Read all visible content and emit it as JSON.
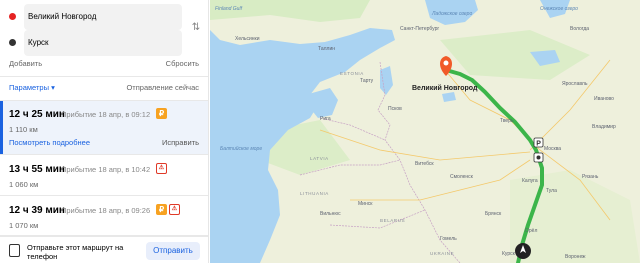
{
  "route_points": {
    "from": "Великий Новгород",
    "to": "Курск",
    "add_label": "Добавить",
    "reset_label": "Сбросить"
  },
  "options": {
    "params_label": "Параметры",
    "departure_label": "Отправление сейчас"
  },
  "routes": [
    {
      "duration": "12 ч 25 мин",
      "arrival": "Прибытие 18 апр, в 09:12",
      "distance": "1 110 км",
      "badge": "₽",
      "details_label": "Посмотреть подробнее",
      "fix_label": "Исправить"
    },
    {
      "duration": "13 ч 55 мин",
      "arrival": "Прибытие 18 апр, в 10:42",
      "distance": "1 060 км",
      "badge": "⚠"
    },
    {
      "duration": "12 ч 39 мин",
      "arrival": "Прибытие 18 апр, в 09:26",
      "distance": "1 070 км",
      "badge1": "₽",
      "badge2": "⚠"
    }
  ],
  "send": {
    "text": "Отправьте этот маршрут на телефон",
    "button": "Отправить"
  },
  "map": {
    "destination_label": "Великий Новгород",
    "countries": [
      "ESTONIA",
      "LATVIA",
      "LITHUANIA",
      "BELARUS",
      "UKRAINE"
    ],
    "cities": [
      "Хельсинки",
      "Санкт-Петербург",
      "Таллин",
      "Тарту",
      "Псков",
      "Рига",
      "Вильнюс",
      "Минск",
      "Гомель",
      "Тверь",
      "Москва",
      "Тула",
      "Калуга",
      "Брянск",
      "Смоленск",
      "Витебск",
      "Ярославль",
      "Владимир",
      "Рязань",
      "Орёл",
      "Воронеж",
      "Курск",
      "Вологда",
      "Иваново"
    ],
    "water": [
      "Finland Gulf",
      "Ладожское озеро",
      "Онежское озеро",
      "Балтийское море"
    ],
    "colors": {
      "route": "#3cb54a",
      "pin": "#f15a29",
      "water": "#aad3f2",
      "land": "#eef0dc",
      "forest": "#d8ecc4"
    }
  }
}
